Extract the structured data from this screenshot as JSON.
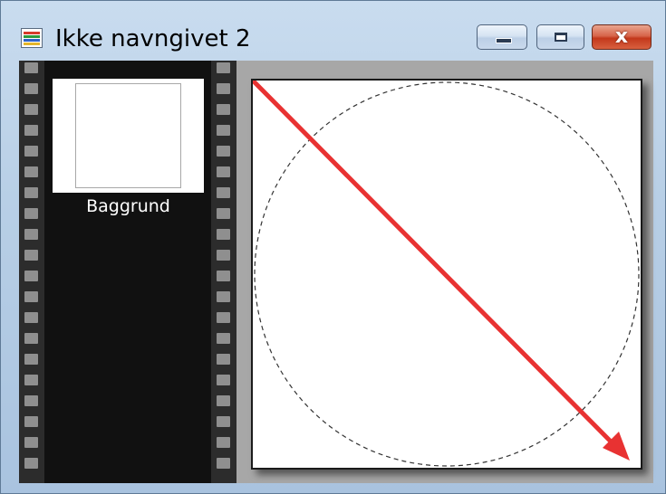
{
  "window": {
    "title": "Ikke navngivet 2",
    "close_symbol": "x",
    "icon": "image-document-icon"
  },
  "layers_panel": {
    "layers": [
      {
        "label": "Baggrund"
      }
    ]
  },
  "canvas": {
    "selection": "ellipse-dashed",
    "annotation": "red-arrow-diagonal",
    "arrow_color": "#e83232"
  },
  "colors": {
    "filmstrip": "#111111",
    "sprocket": "#8f8f8f",
    "workspace": "#a7a7a7",
    "close_button": "#c3381b"
  }
}
